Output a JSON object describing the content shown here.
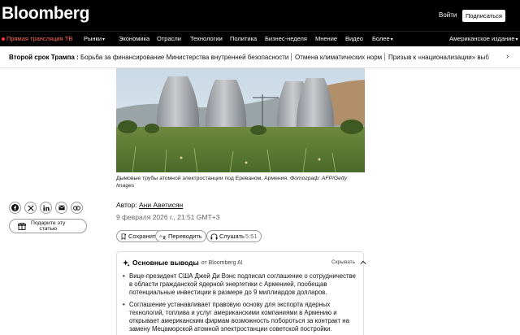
{
  "header": {
    "logo": "Bloomberg",
    "login": "Войти",
    "subscribe": "Подписаться"
  },
  "nav": {
    "live": "Прямая трансляция ТВ",
    "items": [
      "Рынки",
      "Экономика",
      "Отрасли",
      "Технологии",
      "Политика",
      "Бизнес-неделя",
      "Мнение",
      "Видео",
      "Более"
    ],
    "edition": "Американское издание"
  },
  "trending": {
    "label": "Второй срок Трампа :",
    "items": [
      "Борьба за финансирование Министерства внутренней безопасности",
      "Отмена климатических норм",
      "Призыв к «национализации» выб"
    ]
  },
  "photo": {
    "caption": "Дымовые трубы атомной электростанции под Ереваном, Армения.",
    "credit": "Фотограф: AFP/Getty Images"
  },
  "share": {
    "gift_line1": "Подарите эту",
    "gift_line2": "статью"
  },
  "byline": {
    "prefix": "Автор:",
    "author": "Ани Аветисян",
    "date": "9 февраля 2026 г., 21:51 GMT+3"
  },
  "actions": {
    "save": "Сохранить",
    "translate": "Переводить",
    "listen": "Слушать",
    "listen_time": "5:51"
  },
  "takeaways": {
    "title": "Основные выводы",
    "source": "от Bloomberg AI",
    "collapse": "Скрывать",
    "items": [
      "Вице-президент США Джей Ди Вэнс подписал соглашение о сотрудничестве в области гражданской ядерной энергетики с Арменией, пообещав потенциальные инвестиции в размере до 9 миллиардов долларов.",
      "Соглашение устанавливает правовую основу для экспорта ядерных технологий, топлива и услуг американскими компаниями в Армению и открывает американским фирмам возможность побороться за контракт на замену Мецаморской атомной электростанции советской постройки."
    ]
  },
  "colors": {
    "topbar": "#000000",
    "live": "#ff3b30"
  }
}
